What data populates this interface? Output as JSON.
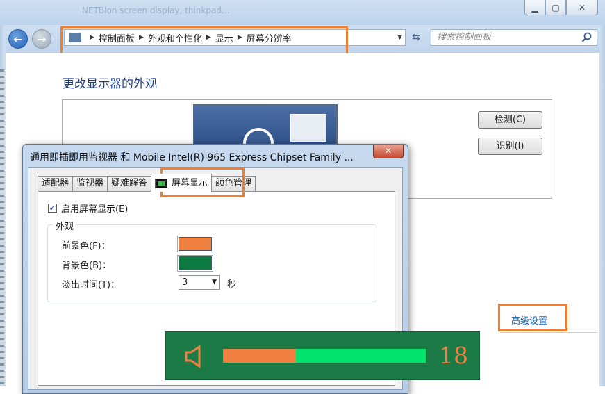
{
  "window": {
    "ghost_title": "NETBlon screen display, thinkpad..."
  },
  "nav": {
    "breadcrumbs": [
      "控制面板",
      "外观和个性化",
      "显示",
      "屏幕分辨率"
    ],
    "search_placeholder": "搜索控制面板"
  },
  "main": {
    "title": "更改显示器的外观",
    "detect_button": "检测(C)",
    "identify_button": "识别(I)",
    "advanced_link": "高级设置"
  },
  "dialog": {
    "title": "通用即插即用监视器 和 Mobile Intel(R) 965 Express Chipset Family ...",
    "close_label": "✕",
    "tabs": [
      "适配器",
      "监视器",
      "疑难解答",
      "屏幕显示",
      "颜色管理"
    ],
    "active_tab": "屏幕显示",
    "enable_osd_label": "启用屏幕显示(E)",
    "enable_osd_checked": true,
    "appearance_group": "外观",
    "foreground_label": "前景色(F)：",
    "foreground_color": "#f08040",
    "background_label": "背景色(B)：",
    "background_color": "#0a7a40",
    "fade_label": "淡出时间(T)：",
    "fade_value": "3",
    "fade_unit": "秒"
  },
  "osd": {
    "volume": 18,
    "volume_fraction": 0.36,
    "track_color": "#00e36d",
    "fill_color": "#f08040",
    "bg_color": "#1b7a45"
  },
  "icons": {
    "back": "arrow-left-icon",
    "forward": "arrow-right-icon",
    "refresh": "refresh-icon",
    "search": "search-icon",
    "speaker": "speaker-icon"
  },
  "highlight_color": "#f07f2d"
}
